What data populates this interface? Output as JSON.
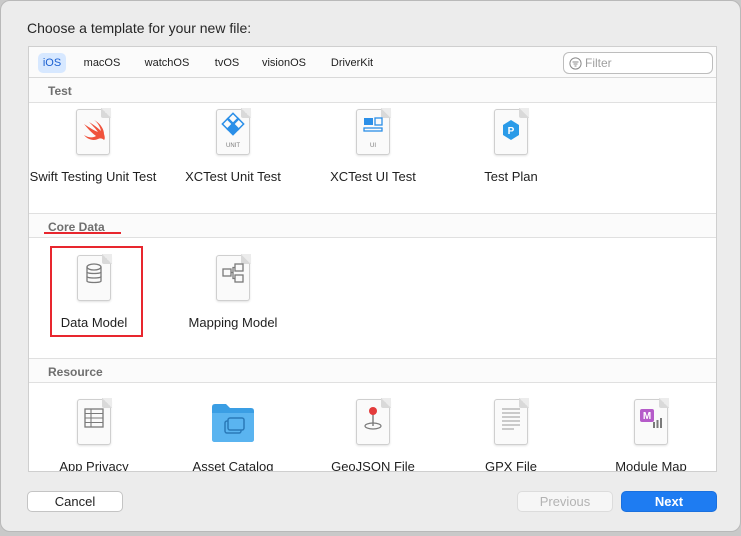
{
  "dialog": {
    "heading": "Choose a template for your new file:"
  },
  "platform_tabs": [
    {
      "label": "iOS",
      "active": true
    },
    {
      "label": "macOS",
      "active": false
    },
    {
      "label": "watchOS",
      "active": false
    },
    {
      "label": "tvOS",
      "active": false
    },
    {
      "label": "visionOS",
      "active": false
    },
    {
      "label": "DriverKit",
      "active": false
    }
  ],
  "filter": {
    "placeholder": "Filter",
    "value": ""
  },
  "sections": {
    "test": {
      "title": "Test",
      "items": [
        {
          "label": "Swift Testing Unit Test",
          "icon": "swift-icon"
        },
        {
          "label": "XCTest Unit Test",
          "icon": "unit-test-icon"
        },
        {
          "label": "XCTest UI Test",
          "icon": "ui-test-icon"
        },
        {
          "label": "Test Plan",
          "icon": "test-plan-icon"
        }
      ]
    },
    "core_data": {
      "title": "Core Data",
      "items": [
        {
          "label": "Data Model",
          "icon": "database-icon",
          "selected": true
        },
        {
          "label": "Mapping Model",
          "icon": "mapping-model-icon"
        }
      ]
    },
    "resource": {
      "title": "Resource",
      "items": [
        {
          "label": "App Privacy",
          "icon": "table-icon"
        },
        {
          "label": "Asset Catalog",
          "icon": "folder-icon"
        },
        {
          "label": "GeoJSON File",
          "icon": "map-pin-icon"
        },
        {
          "label": "GPX File",
          "icon": "gpx-icon"
        },
        {
          "label": "Module Map",
          "icon": "module-map-icon"
        }
      ]
    }
  },
  "unit_badge": "UNIT",
  "ui_badge": "UI",
  "plan_badge": "P",
  "module_badge": "M",
  "buttons": {
    "cancel": "Cancel",
    "previous": "Previous",
    "next": "Next"
  },
  "colors": {
    "accent": "#1e7cf2",
    "annotation": "#e8262e",
    "tab_active_bg": "#d7e8ff"
  }
}
